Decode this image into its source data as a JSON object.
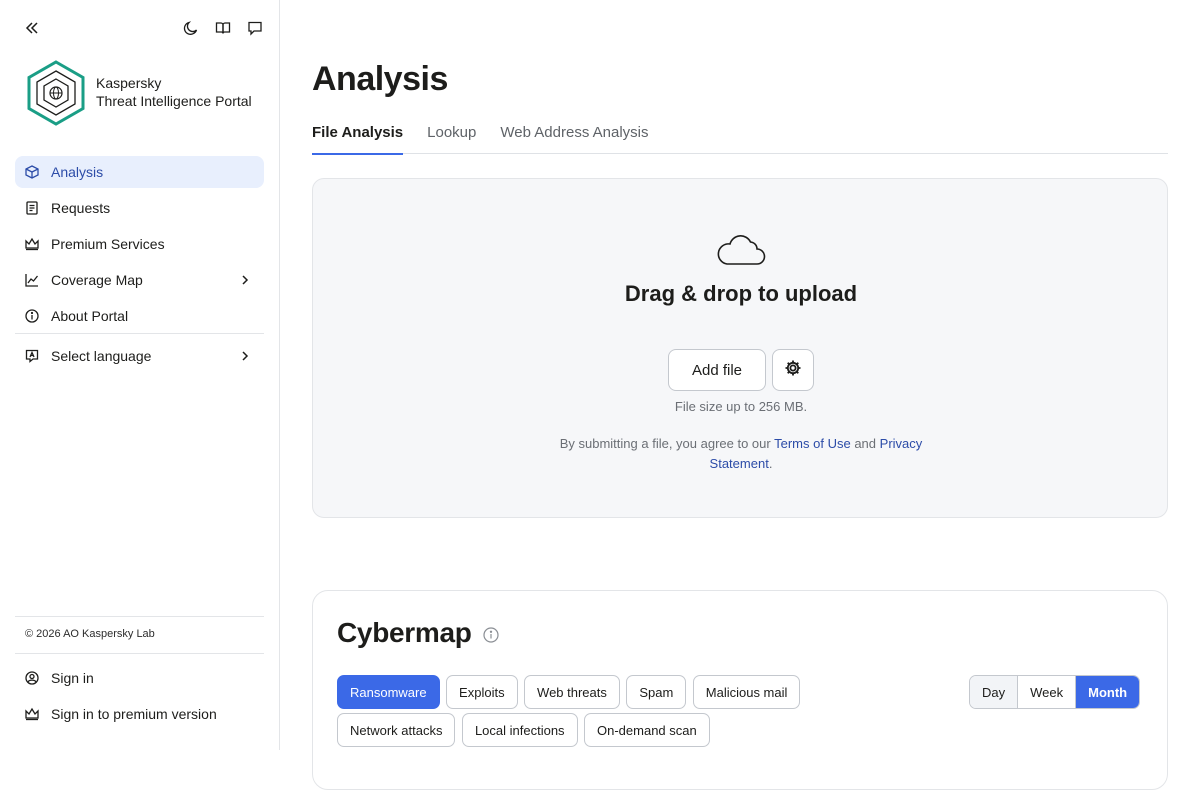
{
  "sidebar": {
    "brand_line1": "Kaspersky",
    "brand_line2": "Threat Intelligence Portal",
    "nav": [
      {
        "label": "Analysis",
        "icon": "cube-icon"
      },
      {
        "label": "Requests",
        "icon": "document-icon"
      },
      {
        "label": "Premium Services",
        "icon": "crown-icon"
      },
      {
        "label": "Coverage Map",
        "icon": "chart-line-icon"
      },
      {
        "label": "About Portal",
        "icon": "info-icon"
      }
    ],
    "language_label": "Select language",
    "copyright": "© 2026 AO Kaspersky Lab",
    "sign_in": "Sign in",
    "sign_in_premium": "Sign in to premium version"
  },
  "main": {
    "title": "Analysis",
    "tabs": [
      "File Analysis",
      "Lookup",
      "Web Address Analysis"
    ],
    "upload": {
      "title": "Drag & drop to upload",
      "add_file": "Add file",
      "size_note": "File size up to 256 MB.",
      "terms_prefix": "By submitting a file, you agree to our",
      "terms_link": "Terms of Use",
      "terms_and": "and",
      "privacy_link": "Privacy Statement",
      "terms_suffix": "."
    },
    "cybermap": {
      "title": "Cybermap",
      "categories": [
        "Ransomware",
        "Exploits",
        "Web threats",
        "Spam",
        "Malicious mail",
        "Network attacks",
        "Local infections",
        "On-demand scan"
      ],
      "periods": [
        "Day",
        "Week",
        "Month"
      ]
    }
  },
  "colors": {
    "accent": "#3b69e7",
    "active_bg": "#e8effd",
    "logo_teal": "#1a9e86"
  }
}
